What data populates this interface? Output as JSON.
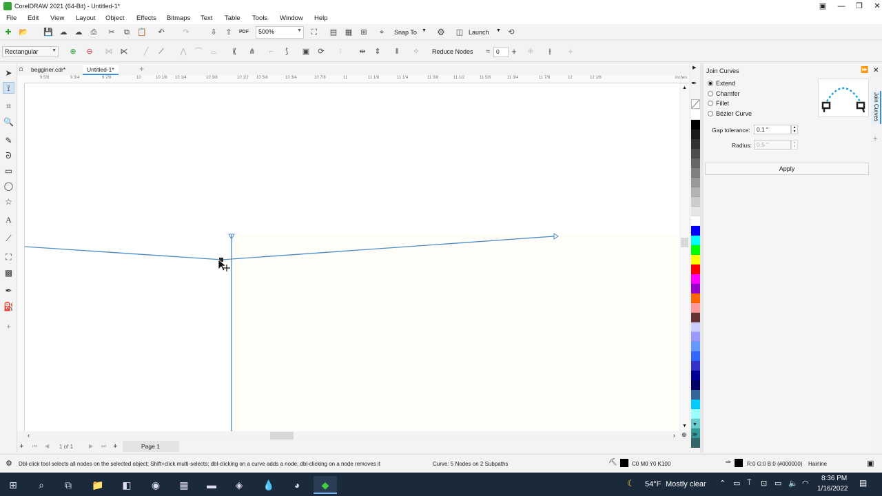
{
  "window": {
    "title": "CorelDRAW 2021 (64-Bit) - Untitled-1*",
    "controls": [
      "restore-grid-icon",
      "minimize-icon",
      "maximize-icon",
      "close-icon"
    ]
  },
  "menu": [
    "File",
    "Edit",
    "View",
    "Layout",
    "Object",
    "Effects",
    "Bitmaps",
    "Text",
    "Table",
    "Tools",
    "Window",
    "Help"
  ],
  "standard_toolbar": {
    "zoom": "500%",
    "snap_to": "Snap To",
    "launch": "Launch",
    "pdf_label": "PDF"
  },
  "property_bar": {
    "selection_mode": "Rectangular",
    "reduce_nodes": "Reduce Nodes",
    "curve_smoothness": "0"
  },
  "doc_tabs": [
    {
      "label": "begginer.cdr*",
      "active": false
    },
    {
      "label": "Untitled-1*",
      "active": true
    }
  ],
  "ruler": {
    "units": "inches",
    "ticks": [
      "9 5/8",
      "9 3/4",
      "9 7/8",
      "10",
      "10 1/8",
      "10 1/4",
      "10 3/8",
      "10 1/2",
      "10 5/8",
      "10 3/4",
      "10 7/8",
      "11",
      "11 1/8",
      "11 1/4",
      "11 3/8",
      "11 1/2",
      "11 5/8",
      "11 3/4",
      "11 7/8",
      "12",
      "12 1/8"
    ]
  },
  "page_nav": {
    "count": "1 of 1",
    "page_tab": "Page 1"
  },
  "docker": {
    "title": "Join Curves",
    "tab_label": "Join Curves",
    "options": [
      {
        "label": "Extend",
        "selected": true
      },
      {
        "label": "Chamfer",
        "selected": false
      },
      {
        "label": "Fillet",
        "selected": false
      },
      {
        "label": "Bézier Curve",
        "selected": false
      }
    ],
    "gap_tolerance_label": "Gap tolerance:",
    "gap_tolerance_value": "0.1 \"",
    "radius_label": "Radius:",
    "radius_value": "0.5 \"",
    "apply_label": "Apply"
  },
  "palette_colors": [
    "#ffffff",
    "#000000",
    "#1a1a1a",
    "#333333",
    "#4d4d4d",
    "#666666",
    "#808080",
    "#999999",
    "#b3b3b3",
    "#cccccc",
    "#e6e6e6",
    "#ffffff",
    "#0000ff",
    "#00ffff",
    "#00ff00",
    "#ffff00",
    "#ff0000",
    "#ff00ff",
    "#9900cc",
    "#ff6600",
    "#ff9999",
    "#663333",
    "#ccccff",
    "#9999ff",
    "#6699ff",
    "#3366ff",
    "#3333cc",
    "#000099",
    "#000066",
    "#336699",
    "#00ccff",
    "#99ffff",
    "#66cccc",
    "#339999",
    "#336666"
  ],
  "status": {
    "hint": "Dbl-click tool selects all nodes on the selected object; Shift+click multi-selects; dbl-clicking on a curve adds a node; dbl-clicking on a node removes it",
    "object_info": "Curve: 5 Nodes on 2 Subpaths",
    "fill": "C0 M0 Y0 K100",
    "outline": "R:0 G:0 B:0 (#000000)",
    "outline_width": "Hairline"
  },
  "taskbar": {
    "temperature": "54°F",
    "weather": "Mostly clear",
    "time": "8:36 PM",
    "date": "1/16/2022"
  }
}
